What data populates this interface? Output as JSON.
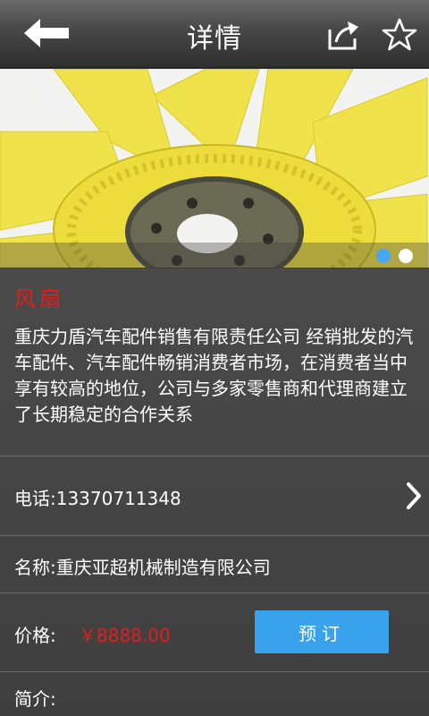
{
  "header": {
    "title": "详情",
    "back_icon": "arrow-left-icon",
    "share_icon": "share-icon",
    "favorite_icon": "star-outline-icon"
  },
  "banner": {
    "image": "yellow fan blade photo",
    "slides_total": 2,
    "active_slide": 1,
    "colors": {
      "active_dot": "#45a7f0",
      "inactive_dot": "#ffffff"
    }
  },
  "product": {
    "name": "风扇",
    "description": "重庆力盾汽车配件销售有限责任公司 经销批发的汽车配件、汽车配件畅销消费者市场，在消费者当中享有较高的地位，公司与多家零售商和代理商建立了长期稳定的合作关系"
  },
  "details": {
    "phone": "电话:13370711348",
    "company": "名称:重庆亚超机械制造有限公司",
    "price_label": "价格:",
    "price_value": "￥8888.00",
    "reserve_button": "预订",
    "intro_label": "简介:"
  },
  "colors": {
    "accent": "#39a2ec",
    "price": "#e01e1e",
    "background": "#3f3f3f"
  }
}
